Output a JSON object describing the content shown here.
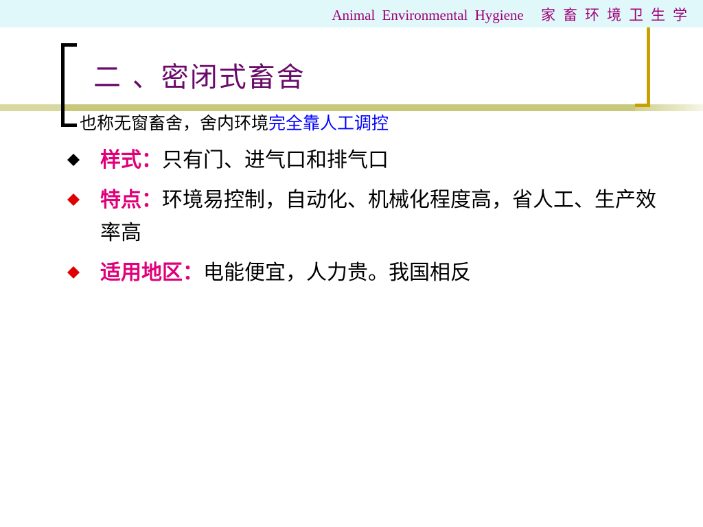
{
  "header": {
    "english": "Animal  Environmental  Hygiene",
    "chinese": "家畜环境卫生学"
  },
  "title": "二 、密闭式畜舍",
  "subtitle": {
    "prefix": "也称无窗畜舍，舍内环境",
    "highlight": "完全靠人工调控"
  },
  "bullets": [
    {
      "label": "样式：",
      "text": "只有门、进气口和排气口",
      "marker_color": "#000000"
    },
    {
      "label": "特点：",
      "text": "环境易控制，自动化、机械化程度高，省人工、生产效率高",
      "marker_color": "#e00000"
    },
    {
      "label": "适用地区：",
      "text": "电能便宜，人力贵。我国相反",
      "marker_color": "#e00000"
    }
  ],
  "colors": {
    "title": "#6a0a6a",
    "label": "#e0007a",
    "highlight": "#0000ff",
    "header_text": "#a00078",
    "band": "#e0f8fa",
    "right_bracket": "#c8a000"
  },
  "icons": {
    "bullet_marker": "diamond-icon"
  }
}
